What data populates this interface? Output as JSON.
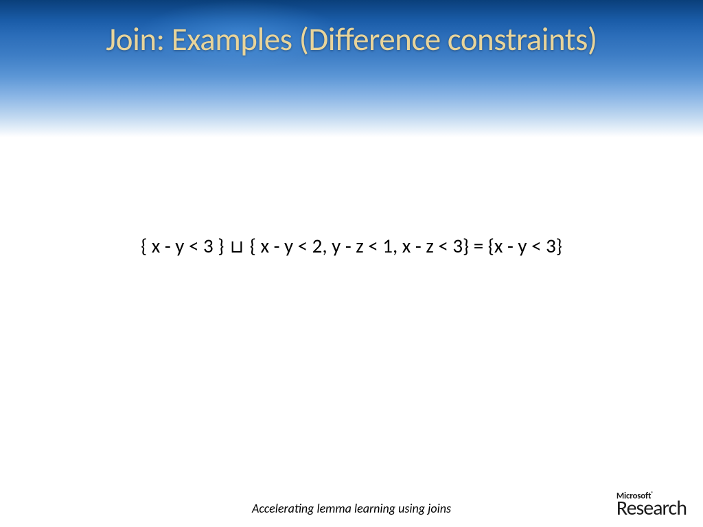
{
  "slide": {
    "title": "Join: Examples (Difference constraints)",
    "equation_left": "{ x - y < 3 } ",
    "equation_symbol": "⊔",
    "equation_right": " { x - y < 2, y - z < 1, x - z < 3} = {x - y < 3}",
    "footer_caption": "Accelerating lemma learning using joins"
  },
  "logo": {
    "company": "Microsoft",
    "division": "Research"
  }
}
